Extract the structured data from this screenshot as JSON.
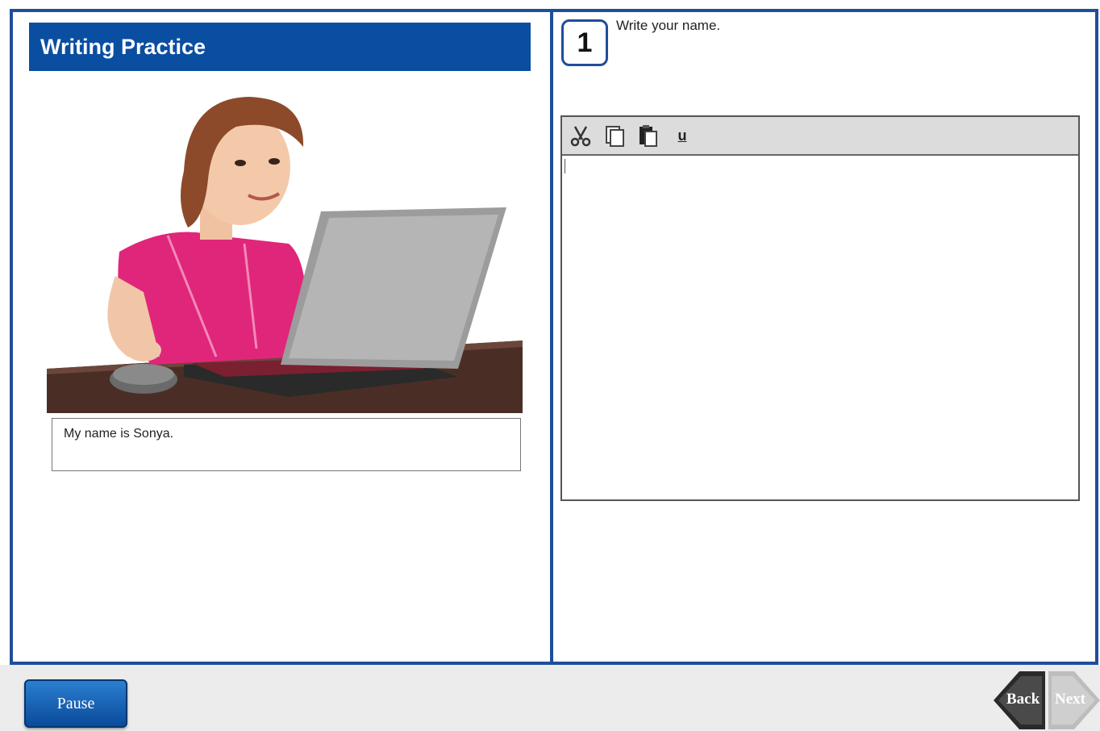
{
  "left_panel": {
    "title": "Writing Practice",
    "caption": "My name is Sonya."
  },
  "question": {
    "number": "1",
    "prompt": "Write your name."
  },
  "editor": {
    "toolbar": [
      {
        "name": "cut-icon"
      },
      {
        "name": "copy-icon"
      },
      {
        "name": "paste-icon"
      },
      {
        "name": "underline-icon",
        "glyph": "u"
      }
    ],
    "value": ""
  },
  "footer": {
    "pause_label": "Pause",
    "back_label": "Back",
    "next_label": "Next"
  },
  "colors": {
    "frame_blue": "#1f4e9b",
    "title_blue": "#0a4ea1",
    "toolbar_gray": "#dcdcdc"
  }
}
